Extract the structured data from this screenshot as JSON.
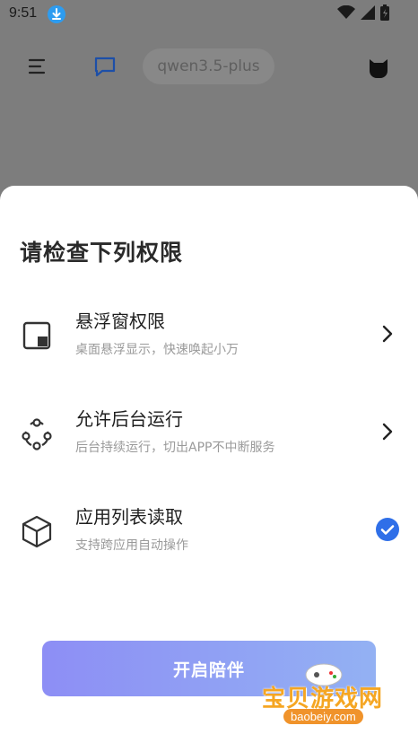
{
  "status_bar": {
    "time": "9:51",
    "icons": [
      "download-icon",
      "wifi-icon",
      "signal-icon",
      "battery-charging-icon"
    ]
  },
  "app_bar": {
    "icons": [
      "menu-icon",
      "chat-icon",
      "avatar-cat-icon"
    ],
    "model_name": "qwen3.5-plus"
  },
  "sheet": {
    "title": "请检查下列权限",
    "permissions": [
      {
        "icon": "floating-window-icon",
        "title": "悬浮窗权限",
        "description": "桌面悬浮显示，快速唤起小万",
        "action": "chevron-right-icon"
      },
      {
        "icon": "background-run-icon",
        "title": "允许后台运行",
        "description": "后台持续运行，切出APP不中断服务",
        "action": "chevron-right-icon"
      },
      {
        "icon": "app-list-cube-icon",
        "title": "应用列表读取",
        "description": "支持跨应用自动操作",
        "action": "check-circle-icon"
      }
    ],
    "start_button_label": "开启陪伴"
  },
  "watermark": {
    "text": "宝贝游戏网",
    "url": "baobeiy.com"
  },
  "colors": {
    "accent_blue": "#2f6fe8",
    "button_gradient_start": "#8d8ef5",
    "button_gradient_end": "#93b1f3",
    "watermark_orange": "#f5a623"
  }
}
